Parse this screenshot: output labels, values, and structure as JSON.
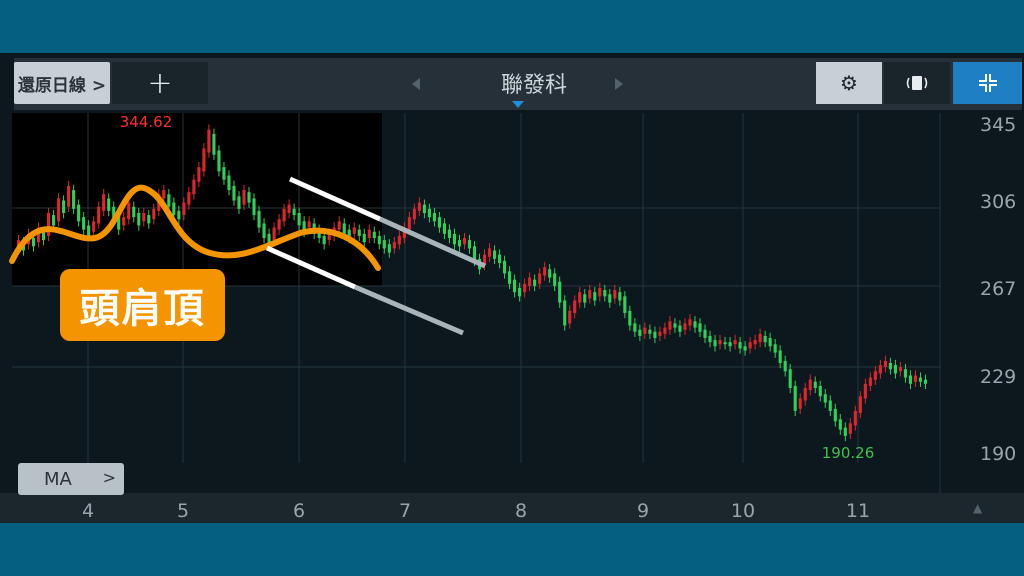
{
  "header": {
    "restore_label": "還原日線 >",
    "add_label": "+",
    "stock_name": "聯發科",
    "icons": {
      "prev": "chevron-left-icon",
      "next": "chevron-right-icon",
      "settings": "gear-icon",
      "rotate": "rotate-icon",
      "fullscreen": "fullscreen-icon"
    }
  },
  "indicator_button": {
    "label": "MA",
    "chevron": ">"
  },
  "annotation": {
    "badge_text": "頭肩頂",
    "colors": {
      "badge": "#f49400",
      "curve": "#f49400",
      "channel": "#ffffff"
    }
  },
  "chart_data": {
    "type": "candlestick",
    "title": "",
    "x_ticks": [
      "4",
      "5",
      "6",
      "7",
      "8",
      "9",
      "10",
      "11"
    ],
    "y_ticks": [
      "345",
      "306",
      "267",
      "229",
      "190"
    ],
    "ylim": [
      180,
      348
    ],
    "max_label": "344.62",
    "min_label": "190.26",
    "colors": {
      "up": "#e0262c",
      "down": "#2fd15a",
      "max_label": "#ff2b2b",
      "min_label": "#3ec24b",
      "grid": "#25343c",
      "axis_text": "#9aa4aa"
    },
    "candles": [
      [
        283,
        287
      ],
      [
        286,
        282
      ],
      [
        285,
        290
      ],
      [
        288,
        284
      ],
      [
        286,
        293
      ],
      [
        291,
        287
      ],
      [
        289,
        300
      ],
      [
        299,
        294
      ],
      [
        296,
        307
      ],
      [
        306,
        300
      ],
      [
        303,
        313
      ],
      [
        311,
        302
      ],
      [
        304,
        296
      ],
      [
        298,
        292
      ],
      [
        294,
        289
      ],
      [
        291,
        296
      ],
      [
        295,
        303
      ],
      [
        301,
        309
      ],
      [
        307,
        301
      ],
      [
        303,
        297
      ],
      [
        299,
        292
      ],
      [
        294,
        298
      ],
      [
        297,
        305
      ],
      [
        303,
        298
      ],
      [
        300,
        294
      ],
      [
        296,
        300
      ],
      [
        299,
        295
      ],
      [
        297,
        302
      ],
      [
        301,
        309
      ],
      [
        307,
        311
      ],
      [
        309,
        303
      ],
      [
        305,
        299
      ],
      [
        301,
        297
      ],
      [
        299,
        305
      ],
      [
        304,
        310
      ],
      [
        309,
        316
      ],
      [
        315,
        322
      ],
      [
        320,
        331
      ],
      [
        329,
        340
      ],
      [
        338,
        328
      ],
      [
        330,
        320
      ],
      [
        322,
        316
      ],
      [
        318,
        311
      ],
      [
        313,
        306
      ],
      [
        308,
        302
      ],
      [
        304,
        311
      ],
      [
        310,
        305
      ],
      [
        307,
        299
      ],
      [
        301,
        293
      ],
      [
        295,
        288
      ],
      [
        290,
        285
      ],
      [
        287,
        293
      ],
      [
        292,
        297
      ],
      [
        296,
        302
      ],
      [
        300,
        304
      ],
      [
        302,
        299
      ],
      [
        300,
        294
      ],
      [
        296,
        291
      ],
      [
        293,
        296
      ],
      [
        295,
        290
      ],
      [
        292,
        288
      ],
      [
        289,
        285
      ],
      [
        287,
        290
      ],
      [
        289,
        293
      ],
      [
        292,
        296
      ],
      [
        295,
        290
      ],
      [
        292,
        288
      ],
      [
        290,
        293
      ],
      [
        292,
        289
      ],
      [
        290,
        286
      ],
      [
        288,
        292
      ],
      [
        291,
        288
      ],
      [
        289,
        285
      ],
      [
        287,
        283
      ],
      [
        285,
        281
      ],
      [
        283,
        286
      ],
      [
        285,
        289
      ],
      [
        288,
        293
      ],
      [
        292,
        298
      ],
      [
        297,
        302
      ],
      [
        301,
        305
      ],
      [
        304,
        300
      ],
      [
        302,
        298
      ],
      [
        300,
        296
      ],
      [
        298,
        293
      ],
      [
        295,
        290
      ],
      [
        292,
        288
      ],
      [
        290,
        285
      ],
      [
        287,
        284
      ],
      [
        285,
        288
      ],
      [
        287,
        283
      ],
      [
        284,
        277
      ],
      [
        278,
        273
      ],
      [
        275,
        280
      ],
      [
        279,
        283
      ],
      [
        282,
        278
      ],
      [
        280,
        276
      ],
      [
        277,
        271
      ],
      [
        272,
        266
      ],
      [
        268,
        262
      ],
      [
        264,
        260
      ],
      [
        262,
        266
      ],
      [
        265,
        269
      ],
      [
        268,
        265
      ],
      [
        266,
        271
      ],
      [
        270,
        274
      ],
      [
        273,
        269
      ],
      [
        271,
        265
      ],
      [
        267,
        257
      ],
      [
        258,
        246
      ],
      [
        247,
        253
      ],
      [
        252,
        258
      ],
      [
        257,
        262
      ],
      [
        261,
        257
      ],
      [
        259,
        263
      ],
      [
        262,
        258
      ],
      [
        260,
        264
      ],
      [
        263,
        260
      ],
      [
        261,
        257
      ],
      [
        259,
        263
      ],
      [
        262,
        258
      ],
      [
        260,
        252
      ],
      [
        253,
        246
      ],
      [
        247,
        243
      ],
      [
        244,
        241
      ],
      [
        242,
        245
      ],
      [
        244,
        242
      ],
      [
        243,
        240
      ],
      [
        241,
        243
      ],
      [
        242,
        245
      ],
      [
        244,
        248
      ],
      [
        247,
        245
      ],
      [
        246,
        243
      ],
      [
        244,
        247
      ],
      [
        246,
        249
      ],
      [
        248,
        245
      ],
      [
        247,
        243
      ],
      [
        244,
        240
      ],
      [
        241,
        238
      ],
      [
        239,
        236
      ],
      [
        237,
        239
      ],
      [
        238,
        237
      ],
      [
        238,
        236
      ],
      [
        237,
        239
      ],
      [
        238,
        235
      ],
      [
        236,
        234
      ],
      [
        235,
        238
      ],
      [
        237,
        239
      ],
      [
        238,
        242
      ],
      [
        241,
        238
      ],
      [
        240,
        236
      ],
      [
        237,
        233
      ],
      [
        234,
        228
      ],
      [
        229,
        224
      ],
      [
        225,
        216
      ],
      [
        217,
        205
      ],
      [
        206,
        211
      ],
      [
        210,
        216
      ],
      [
        215,
        220
      ],
      [
        219,
        216
      ],
      [
        217,
        212
      ],
      [
        213,
        209
      ],
      [
        210,
        205
      ],
      [
        206,
        200
      ],
      [
        201,
        196
      ],
      [
        197,
        193
      ],
      [
        194,
        199
      ],
      [
        198,
        205
      ],
      [
        204,
        212
      ],
      [
        211,
        218
      ],
      [
        217,
        221
      ],
      [
        220,
        224
      ],
      [
        223,
        227
      ],
      [
        226,
        229
      ],
      [
        228,
        225
      ],
      [
        227,
        223
      ],
      [
        224,
        226
      ],
      [
        225,
        221
      ],
      [
        222,
        218
      ],
      [
        219,
        222
      ],
      [
        221,
        219
      ],
      [
        220,
        218
      ]
    ]
  }
}
